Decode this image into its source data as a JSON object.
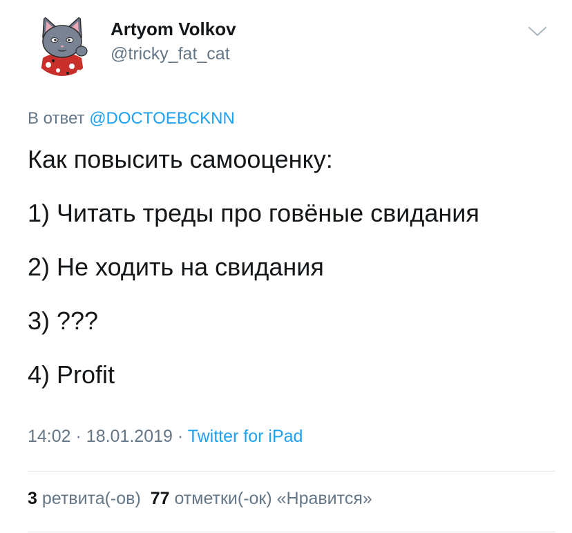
{
  "author": {
    "name": "Artyom Volkov",
    "handle": "@tricky_fat_cat",
    "avatar_icon": "cat-avatar-icon"
  },
  "menu_icon": "chevron-down-icon",
  "reply": {
    "prefix": "В ответ",
    "mention": "@DOCTOEBCKNN"
  },
  "tweet": {
    "lines": [
      "Как повысить самооценку:",
      "1) Читать треды про говёные свидания",
      "2) Не ходить на свидания",
      "3) ???",
      "4) Profit"
    ]
  },
  "meta": {
    "time": "14:02",
    "date": "18.01.2019",
    "separator": "·",
    "source": "Twitter for iPad"
  },
  "stats": {
    "retweets_count": "3",
    "retweets_label": "ретвита(-ов)",
    "likes_count": "77",
    "likes_label": "отметки(-ок) «Нравится»"
  },
  "colors": {
    "link": "#1da1f2",
    "secondary": "#657786",
    "primary": "#14171a",
    "divider": "#e1e8ed"
  }
}
